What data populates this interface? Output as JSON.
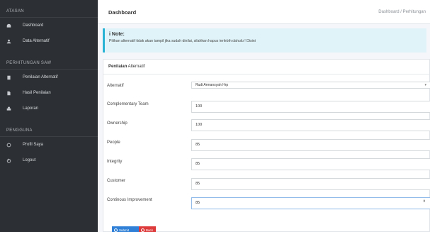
{
  "sidebar": {
    "section_atasan": "ATASAN",
    "dashboard": "Dashboard",
    "data_alternatif": "Data Alternatif",
    "section_perhitungan": "PERHITUNGAN SAW",
    "penilaian_alternatif": "Penilaian Alternatif",
    "hasil_penilaian": "Hasil Penilaian",
    "laporan": "Laporan",
    "section_pengguna": "PENGGUNA",
    "profil_saya": "Profil Saya",
    "logout": "Logout"
  },
  "header": {
    "title": "Dashboard",
    "breadcrumb": "Dashboard / Perhitungan"
  },
  "note": {
    "title": "i Note:",
    "text": "Pilihan alternatif tidak akan tampil jika sudah dinilai, silahkan hapus terlebih dahulu ! Disini"
  },
  "card": {
    "title_bold": "Penilaian",
    "title_rest": " Alternatif"
  },
  "form": {
    "alternatif_label": "Alternatif",
    "alternatif_value": "Rudi Armansyah Hrp",
    "complementary_label": "Complementary Team",
    "complementary_value": "100",
    "ownership_label": "Ownership",
    "ownership_value": "100",
    "people_label": "People",
    "people_value": "85",
    "integrity_label": "Integrity",
    "integrity_value": "85",
    "customer_label": "Customer",
    "customer_value": "85",
    "continous_label": "Continous Improvement",
    "continous_value": "85"
  },
  "buttons": {
    "submit": "Submit",
    "back": "Back"
  },
  "colors": {
    "sidebar_bg": "#2c2f33",
    "note_bg": "#dff3f8",
    "note_border": "#2bb3d5",
    "submit": "#2f80d6",
    "back": "#dd3b3b"
  },
  "icons": {
    "dashboard": "tachometer-icon",
    "data_alternatif": "user-icon",
    "penilaian": "clipboard-icon",
    "hasil": "file-icon",
    "laporan": "print-icon",
    "profil": "comment-icon",
    "logout": "power-icon"
  }
}
